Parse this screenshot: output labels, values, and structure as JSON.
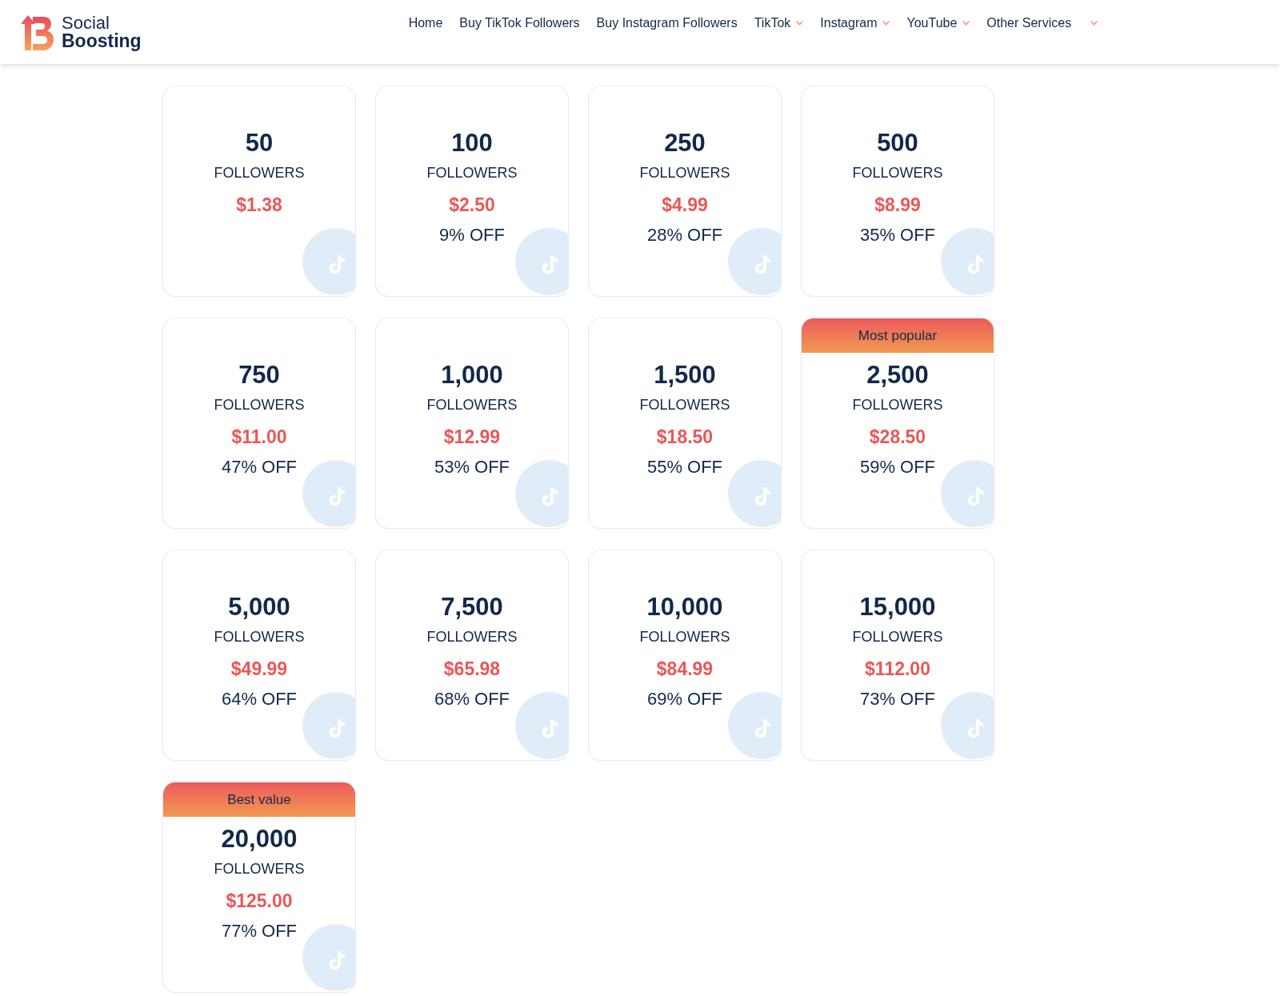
{
  "header": {
    "logo": {
      "line_1": "Social",
      "line_2": "Boosting"
    },
    "nav": [
      {
        "label": "Home",
        "dropdown": false
      },
      {
        "label": "Buy TikTok Followers",
        "dropdown": false
      },
      {
        "label": "Buy Instagram Followers",
        "dropdown": false
      },
      {
        "label": "TikTok",
        "dropdown": true
      },
      {
        "label": "Instagram",
        "dropdown": true
      },
      {
        "label": "YouTube",
        "dropdown": true
      },
      {
        "label": "Other Services",
        "dropdown": true
      }
    ]
  },
  "packages": [
    {
      "quantity": "50",
      "unit": "FOLLOWERS",
      "price": "$1.38"
    },
    {
      "quantity": "100",
      "unit": "FOLLOWERS",
      "price": "$2.50",
      "discount": "9% OFF"
    },
    {
      "quantity": "250",
      "unit": "FOLLOWERS",
      "price": "$4.99",
      "discount": "28% OFF"
    },
    {
      "quantity": "500",
      "unit": "FOLLOWERS",
      "price": "$8.99",
      "discount": "35% OFF"
    },
    {
      "quantity": "750",
      "unit": "FOLLOWERS",
      "price": "$11.00",
      "discount": "47% OFF"
    },
    {
      "quantity": "1,000",
      "unit": "FOLLOWERS",
      "price": "$12.99",
      "discount": "53% OFF"
    },
    {
      "quantity": "1,500",
      "unit": "FOLLOWERS",
      "price": "$18.50",
      "discount": "55% OFF"
    },
    {
      "ribbon": "Most popular",
      "quantity": "2,500",
      "unit": "FOLLOWERS",
      "price": "$28.50",
      "discount": "59% OFF"
    },
    {
      "quantity": "5,000",
      "unit": "FOLLOWERS",
      "price": "$49.99",
      "discount": "64% OFF"
    },
    {
      "quantity": "7,500",
      "unit": "FOLLOWERS",
      "price": "$65.98",
      "discount": "68% OFF"
    },
    {
      "quantity": "10,000",
      "unit": "FOLLOWERS",
      "price": "$84.99",
      "discount": "69% OFF"
    },
    {
      "quantity": "15,000",
      "unit": "FOLLOWERS",
      "price": "$112.00",
      "discount": "73% OFF"
    },
    {
      "ribbon": "Best value",
      "quantity": "20,000",
      "unit": "FOLLOWERS",
      "price": "$125.00",
      "discount": "77% OFF"
    }
  ]
}
